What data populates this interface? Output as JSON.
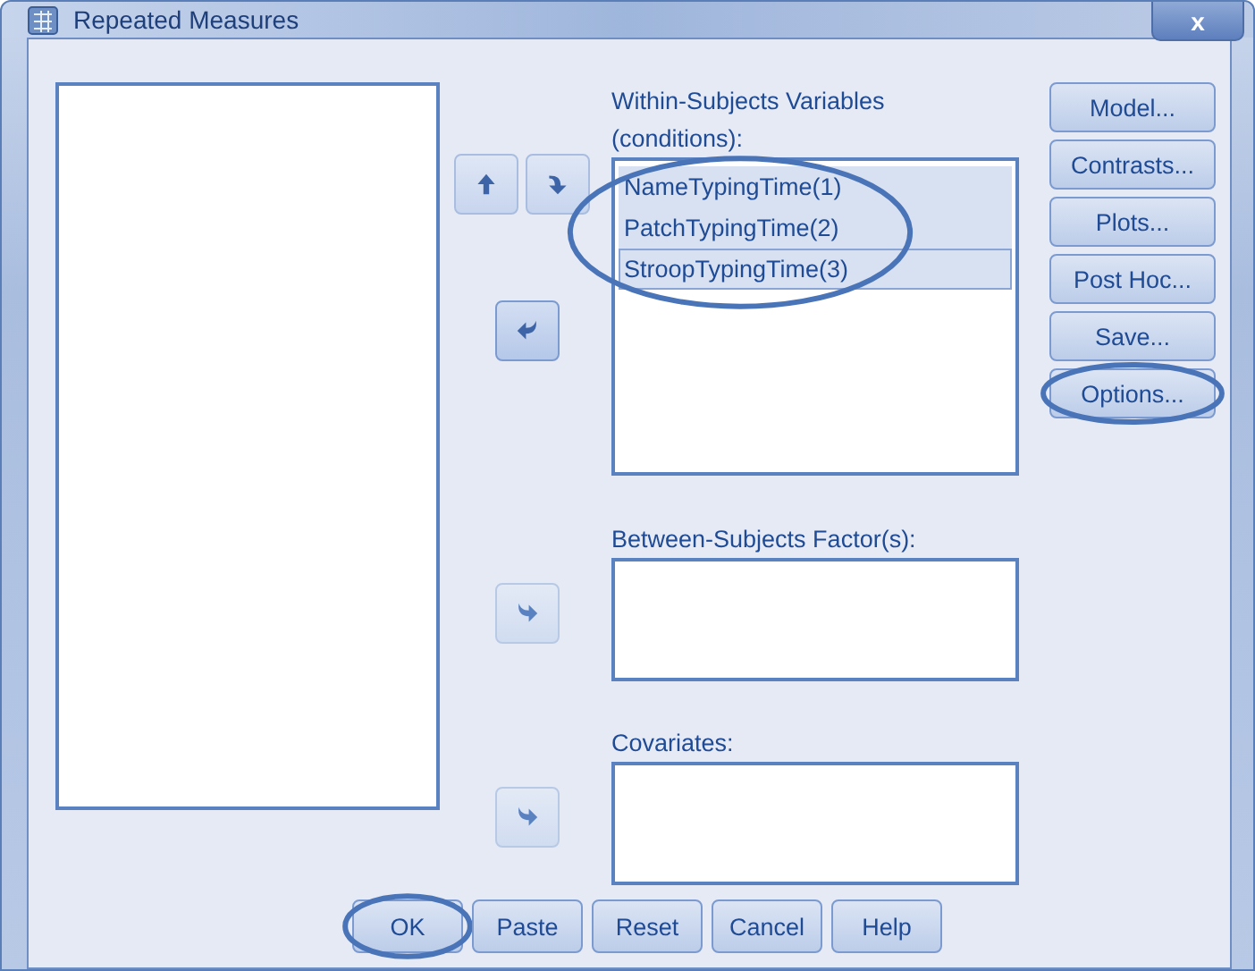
{
  "window": {
    "title": "Repeated Measures",
    "close": "x"
  },
  "within": {
    "label": "Within-Subjects Variables (conditions):",
    "highlighted": true,
    "items": [
      {
        "label": "NameTypingTime(1)",
        "selected": true,
        "focused": false
      },
      {
        "label": "PatchTypingTime(2)",
        "selected": true,
        "focused": false
      },
      {
        "label": "StroopTypingTime(3)",
        "selected": true,
        "focused": true
      }
    ]
  },
  "move_buttons": [
    {
      "kind": "up",
      "disabled": false
    },
    {
      "kind": "down",
      "disabled": false
    },
    {
      "kind": "left",
      "disabled": false
    }
  ],
  "between": {
    "label": "Between-Subjects Factor(s):",
    "move_button": {
      "kind": "right",
      "disabled": true
    }
  },
  "covariates": {
    "label": "Covariates:",
    "move_button": {
      "kind": "right",
      "disabled": true
    }
  },
  "side_buttons": [
    {
      "label": "Model...",
      "highlighted": false
    },
    {
      "label": "Contrasts...",
      "highlighted": false
    },
    {
      "label": "Plots...",
      "highlighted": false
    },
    {
      "label": "Post Hoc...",
      "highlighted": false
    },
    {
      "label": "Save...",
      "highlighted": false
    },
    {
      "label": "Options...",
      "highlighted": true
    }
  ],
  "bottom_buttons": [
    {
      "label": "OK",
      "highlighted": true
    },
    {
      "label": "Paste",
      "highlighted": false
    },
    {
      "label": "Reset",
      "highlighted": false
    },
    {
      "label": "Cancel",
      "highlighted": false
    },
    {
      "label": "Help",
      "highlighted": false
    }
  ]
}
